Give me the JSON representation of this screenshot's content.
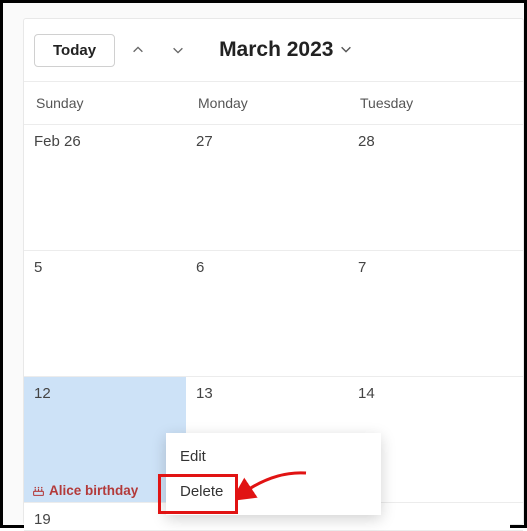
{
  "toolbar": {
    "today_label": "Today",
    "month_label": "March 2023"
  },
  "headers": [
    "Sunday",
    "Monday",
    "Tuesday"
  ],
  "weeks": [
    [
      "Feb 26",
      "27",
      "28"
    ],
    [
      "5",
      "6",
      "7"
    ],
    [
      "12",
      "13",
      "14"
    ],
    [
      "19",
      "",
      ""
    ]
  ],
  "selected_cell": "12",
  "event": {
    "label": "Alice birthday"
  },
  "context_menu": {
    "items": [
      "Edit",
      "Delete"
    ]
  }
}
